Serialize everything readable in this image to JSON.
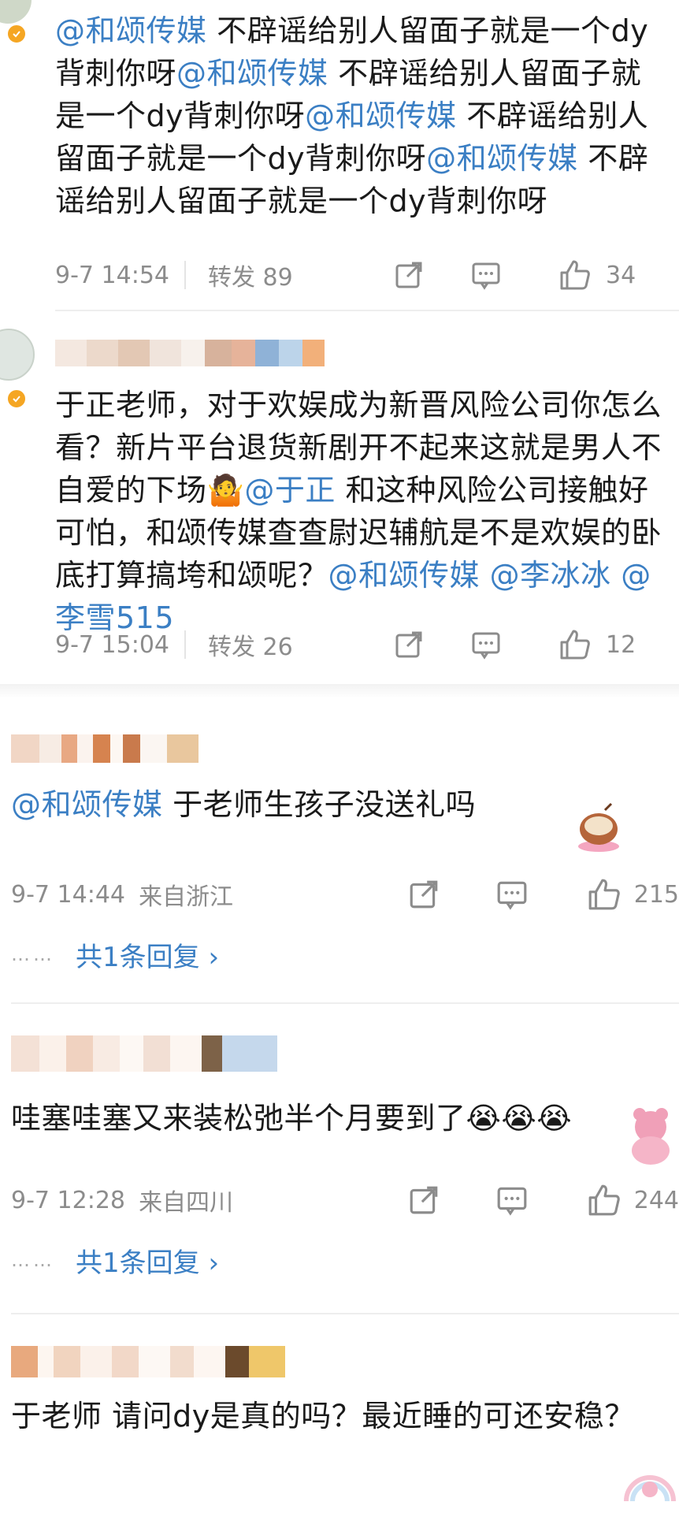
{
  "comments": [
    {
      "text_parts": [
        {
          "t": "@和颂传媒",
          "m": true
        },
        {
          "t": " 不辟谣给别人留面子就是一个dy背刺你呀",
          "m": false
        },
        {
          "t": "@和颂传媒",
          "m": true
        },
        {
          "t": " 不辟谣给别人留面子就是一个dy背刺你呀",
          "m": false
        },
        {
          "t": "@和颂传媒",
          "m": true
        },
        {
          "t": " 不辟谣给别人留面子就是一个dy背刺你呀",
          "m": false
        },
        {
          "t": "@和颂传媒",
          "m": true
        },
        {
          "t": " 不辟谣给别人留面子就是一个dy背刺你呀",
          "m": false
        }
      ],
      "time": "9-7 14:54",
      "repost_label": "转发 89",
      "like_count": "34"
    },
    {
      "text_parts": [
        {
          "t": "于正老师，对于欢娱成为新晋风险公司你怎么看？新片平台退货新剧开不起来这就是男人不自爱的下场",
          "m": false
        },
        {
          "t": "🤷",
          "m": false
        },
        {
          "t": "@于正",
          "m": true
        },
        {
          "t": " 和这种风险公司接触好可怕，和颂传媒查查尉迟辅航是不是欢娱的卧底打算搞垮和颂呢？",
          "m": false
        },
        {
          "t": "@和颂传媒",
          "m": true
        },
        {
          "t": " ",
          "m": false
        },
        {
          "t": "@李冰冰",
          "m": true
        },
        {
          "t": " ",
          "m": false
        },
        {
          "t": "@李雪515",
          "m": true
        }
      ],
      "time": "9-7 15:04",
      "repost_label": "转发 26",
      "like_count": "12"
    },
    {
      "text_parts": [
        {
          "t": "@和颂传媒",
          "m": true
        },
        {
          "t": " 于老师生孩子没送礼吗",
          "m": false
        }
      ],
      "time": "9-7 14:44",
      "location": "来自浙江",
      "like_count": "215",
      "reply_label": "共1条回复 ›",
      "dots": "……"
    },
    {
      "text_parts": [
        {
          "t": "哇塞哇塞又来装松弛半个月要到了😭😭😭",
          "m": false
        }
      ],
      "time": "9-7 12:28",
      "location": "来自四川",
      "like_count": "244",
      "reply_label": "共1条回复 ›",
      "dots": "……"
    },
    {
      "text_parts": [
        {
          "t": "于老师 请问dy是真的吗？最近睡的可还安稳？",
          "m": false
        }
      ]
    }
  ],
  "icons": [
    "share-icon",
    "comment-icon",
    "like-icon"
  ],
  "colors": {
    "mention": "#3b7fc4",
    "meta": "#8c8c8c",
    "badge": "#f5a623"
  }
}
